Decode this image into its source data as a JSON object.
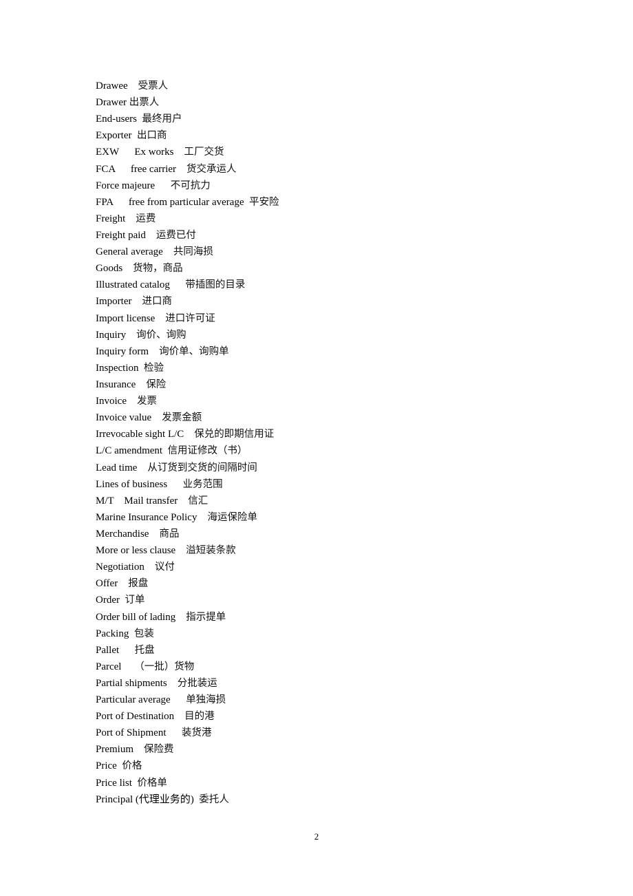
{
  "document": {
    "entries": [
      {
        "term": "Drawee    ",
        "cn": "受票人"
      },
      {
        "term": "Drawer ",
        "cn": "出票人"
      },
      {
        "term": "End-users  ",
        "cn": "最终用户"
      },
      {
        "term": "Exporter  ",
        "cn": "出口商"
      },
      {
        "term": "EXW      Ex works    ",
        "cn": "工厂交货"
      },
      {
        "term": "FCA      free carrier    ",
        "cn": "货交承运人"
      },
      {
        "term": "Force majeure      ",
        "cn": "不可抗力"
      },
      {
        "term": "FPA      free from particular average  ",
        "cn": "平安险"
      },
      {
        "term": "Freight    ",
        "cn": "运费"
      },
      {
        "term": "Freight paid    ",
        "cn": "运费已付"
      },
      {
        "term": "General average    ",
        "cn": "共同海损"
      },
      {
        "term": "Goods    ",
        "cn": "货物，商品"
      },
      {
        "term": "Illustrated catalog      ",
        "cn": "带插图的目录"
      },
      {
        "term": "Importer    ",
        "cn": "进口商"
      },
      {
        "term": "Import license    ",
        "cn": "进口许可证"
      },
      {
        "term": "Inquiry    ",
        "cn": "询价、询购"
      },
      {
        "term": "Inquiry form    ",
        "cn": "询价单、询购单"
      },
      {
        "term": "Inspection  ",
        "cn": "检验"
      },
      {
        "term": "Insurance    ",
        "cn": "保险"
      },
      {
        "term": "Invoice    ",
        "cn": "发票"
      },
      {
        "term": "Invoice value    ",
        "cn": "发票金额"
      },
      {
        "term": "Irrevocable sight L/C    ",
        "cn": "保兑的即期信用证"
      },
      {
        "term": "L/C amendment  ",
        "cn": "信用证修改（书）"
      },
      {
        "term": "Lead time    ",
        "cn": "从订货到交货的间隔时间"
      },
      {
        "term": "Lines of business      ",
        "cn": "业务范围"
      },
      {
        "term": "M/T    Mail transfer    ",
        "cn": "信汇"
      },
      {
        "term": "Marine Insurance Policy    ",
        "cn": "海运保险单"
      },
      {
        "term": "Merchandise    ",
        "cn": "商品"
      },
      {
        "term": "More or less clause    ",
        "cn": "溢短装条款"
      },
      {
        "term": "Negotiation    ",
        "cn": "议付"
      },
      {
        "term": "Offer    ",
        "cn": "报盘"
      },
      {
        "term": "Order  ",
        "cn": "订单"
      },
      {
        "term": "Order bill of lading    ",
        "cn": "指示提单"
      },
      {
        "term": "Packing  ",
        "cn": "包装"
      },
      {
        "term": "Pallet      ",
        "cn": "托盘"
      },
      {
        "term": "Parcel     ",
        "cn": "（一批）货物"
      },
      {
        "term": "Partial shipments    ",
        "cn": "分批装运"
      },
      {
        "term": "Particular average      ",
        "cn": "单独海损"
      },
      {
        "term": "Port of Destination    ",
        "cn": "目的港"
      },
      {
        "term": "Port of Shipment      ",
        "cn": "装货港"
      },
      {
        "term": "Premium    ",
        "cn": "保险费"
      },
      {
        "term": "Price  ",
        "cn": "价格"
      },
      {
        "term": "Price list  ",
        "cn": "价格单"
      },
      {
        "term": "Principal (代理业务的)  ",
        "cn": "委托人"
      }
    ],
    "page_number": "2"
  }
}
